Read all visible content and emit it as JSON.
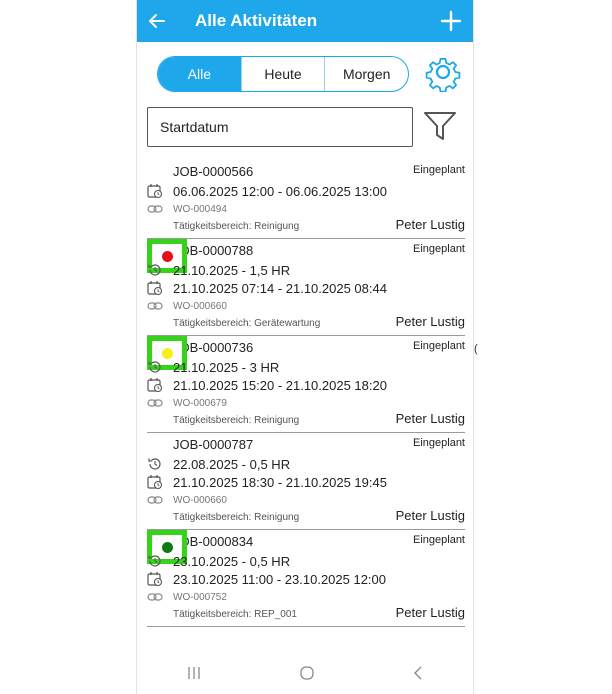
{
  "header": {
    "title": "Alle Aktivitäten"
  },
  "filters": {
    "tabs": [
      "Alle",
      "Heute",
      "Morgen"
    ],
    "active": 0
  },
  "date_filter": {
    "value": "Startdatum"
  },
  "jobs": [
    {
      "id": "JOB-0000566",
      "status": "Eingeplant",
      "estimate": null,
      "range": "06.06.2025 12:00 - 06.06.2025 13:00",
      "wo": "WO-000494",
      "area": "Tätigkeitsbereich: Reinigung",
      "person": "Peter Lustig",
      "marker_color": null
    },
    {
      "id": "JOB-0000788",
      "status": "Eingeplant",
      "estimate": "21.10.2025 - 1,5 HR",
      "range": "21.10.2025 07:14 - 21.10.2025 08:44",
      "wo": "WO-000660",
      "area": "Tätigkeitsbereich: Gerätewartung",
      "person": "Peter Lustig",
      "marker_color": "#e3101b"
    },
    {
      "id": "JOB-0000736",
      "status": "Eingeplant",
      "estimate": "21.10.2025 - 3 HR",
      "range": "21.10.2025 15:20 - 21.10.2025 18:20",
      "wo": "WO-000679",
      "area": "Tätigkeitsbereich: Reinigung",
      "person": "Peter Lustig",
      "marker_color": "#f5ef1a"
    },
    {
      "id": "JOB-0000787",
      "status": "Eingeplant",
      "estimate": "22.08.2025 - 0,5 HR",
      "range": "21.10.2025 18:30 - 21.10.2025 19:45",
      "wo": "WO-000660",
      "area": "Tätigkeitsbereich: Reinigung",
      "person": "Peter Lustig",
      "marker_color": null
    },
    {
      "id": "JOB-0000834",
      "status": "Eingeplant",
      "estimate": "23.10.2025 - 0,5 HR",
      "range": "23.10.2025 11:00 - 23.10.2025 12:00",
      "wo": "WO-000752",
      "area": "Tätigkeitsbereich: REP_001",
      "person": "Peter Lustig",
      "marker_color": "#0e7a16"
    }
  ],
  "edge_text": "("
}
